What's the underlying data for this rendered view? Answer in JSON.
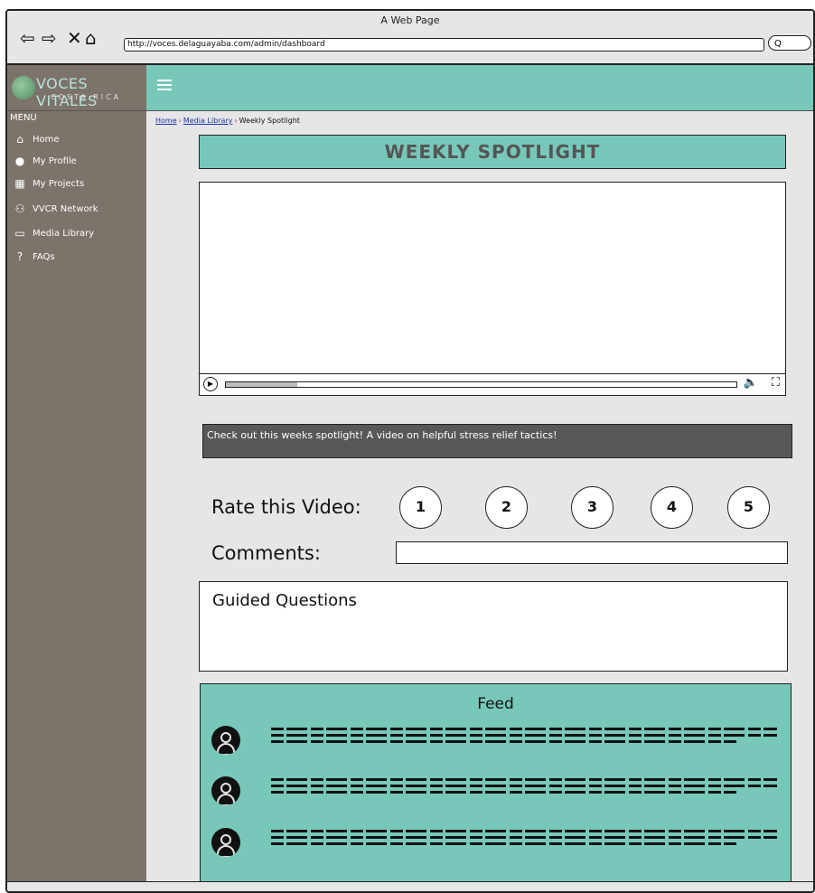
{
  "browser": {
    "window_title": "A Web Page",
    "url": "http://voces.delaguayaba.com/admin/dashboard",
    "search_label": "Q"
  },
  "brand": {
    "title": "VOCES VITALES",
    "subtitle": "COSTA RICA",
    "accent_color": "#77c8b9",
    "sidebar_color": "#7c736b"
  },
  "sidebar": {
    "heading": "MENU",
    "items": [
      {
        "label": "Home",
        "icon": "home-icon"
      },
      {
        "label": "My Profile",
        "icon": "user-icon"
      },
      {
        "label": "My Projects",
        "icon": "projects-icon"
      },
      {
        "label": "VVCR Network",
        "icon": "network-icon"
      },
      {
        "label": "Media Library",
        "icon": "monitor-icon"
      },
      {
        "label": "FAQs",
        "icon": "help-icon"
      }
    ]
  },
  "breadcrumb": {
    "items": [
      "Home",
      "Media Library",
      "Weekly Spotlight"
    ]
  },
  "spotlight": {
    "title": "WEEKLY SPOTLIGHT",
    "caption": "Check out this weeks spotlight! A video on helpful stress relief tactics!",
    "video_progress": 0.14
  },
  "rating": {
    "label": "Rate this Video:",
    "options": [
      "1",
      "2",
      "3",
      "4",
      "5"
    ]
  },
  "comments": {
    "label": "Comments:",
    "value": ""
  },
  "questions": {
    "title": "Guided Questions"
  },
  "feed": {
    "title": "Feed",
    "items": [
      {
        "avatar": "user-avatar-icon"
      },
      {
        "avatar": "user-avatar-icon"
      },
      {
        "avatar": "user-avatar-icon"
      }
    ]
  }
}
